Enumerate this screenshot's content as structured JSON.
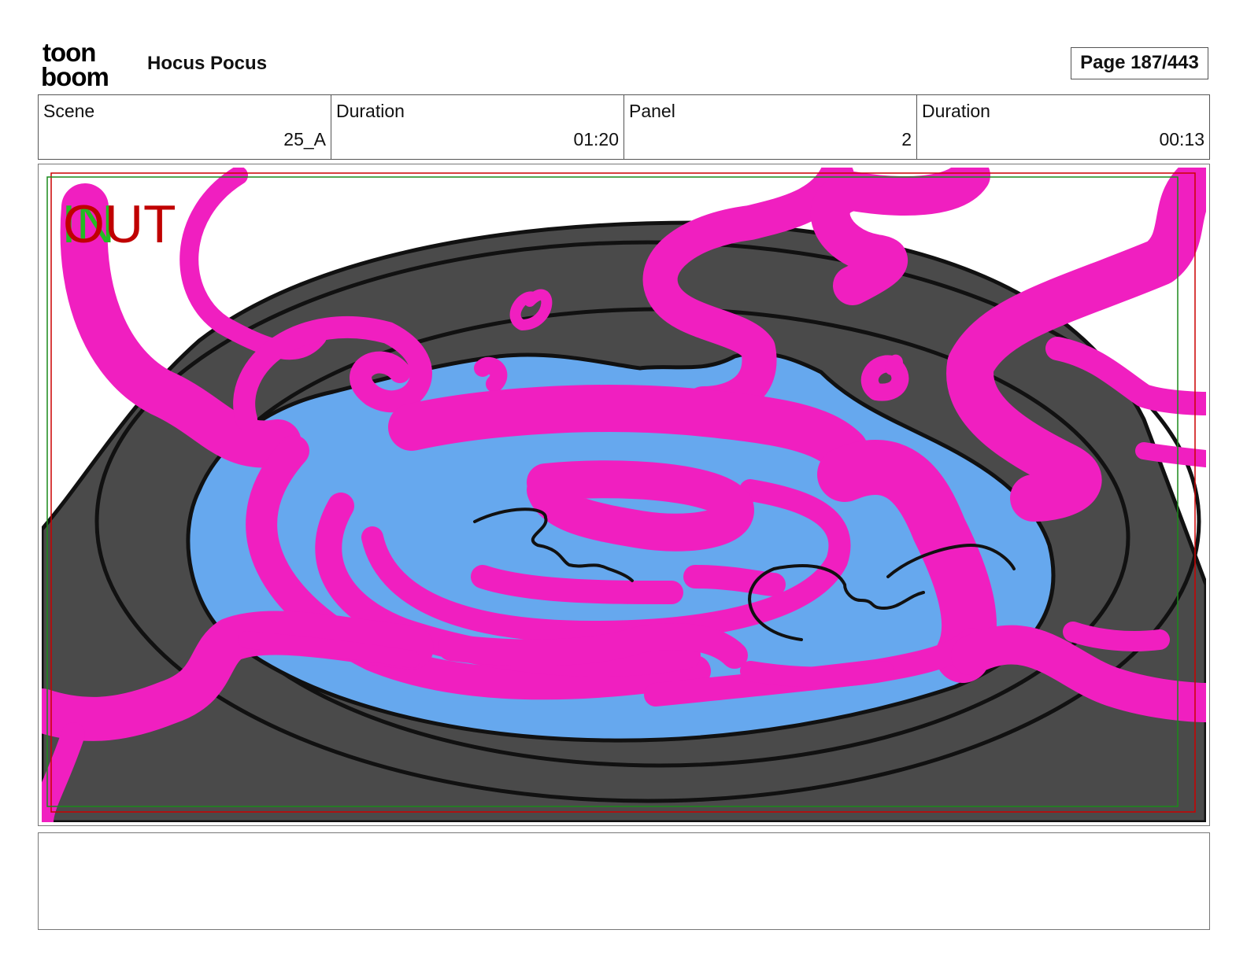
{
  "header": {
    "logo": {
      "name": "toonboom-logo",
      "text_line1": "toon",
      "text_line2": "boom"
    },
    "project_title": "Hocus Pocus",
    "page_label": "Page 187/443"
  },
  "info": [
    {
      "label": "Scene",
      "value": "25_A"
    },
    {
      "label": "Duration",
      "value": "01:20"
    },
    {
      "label": "Panel",
      "value": "2"
    },
    {
      "label": "Duration",
      "value": "00:13"
    }
  ],
  "panel": {
    "overlay_in": "IN",
    "overlay_out": "OUT",
    "colors": {
      "magenta": "#f01fc0",
      "water": "#66a8ee",
      "cauldron": "#4a4a4a",
      "outline": "#111111",
      "frame_red": "#cc0000",
      "frame_green": "#1a8a1a",
      "in_green": "#22bb22",
      "out_red": "#c00000"
    }
  },
  "notes": {
    "text": ""
  }
}
